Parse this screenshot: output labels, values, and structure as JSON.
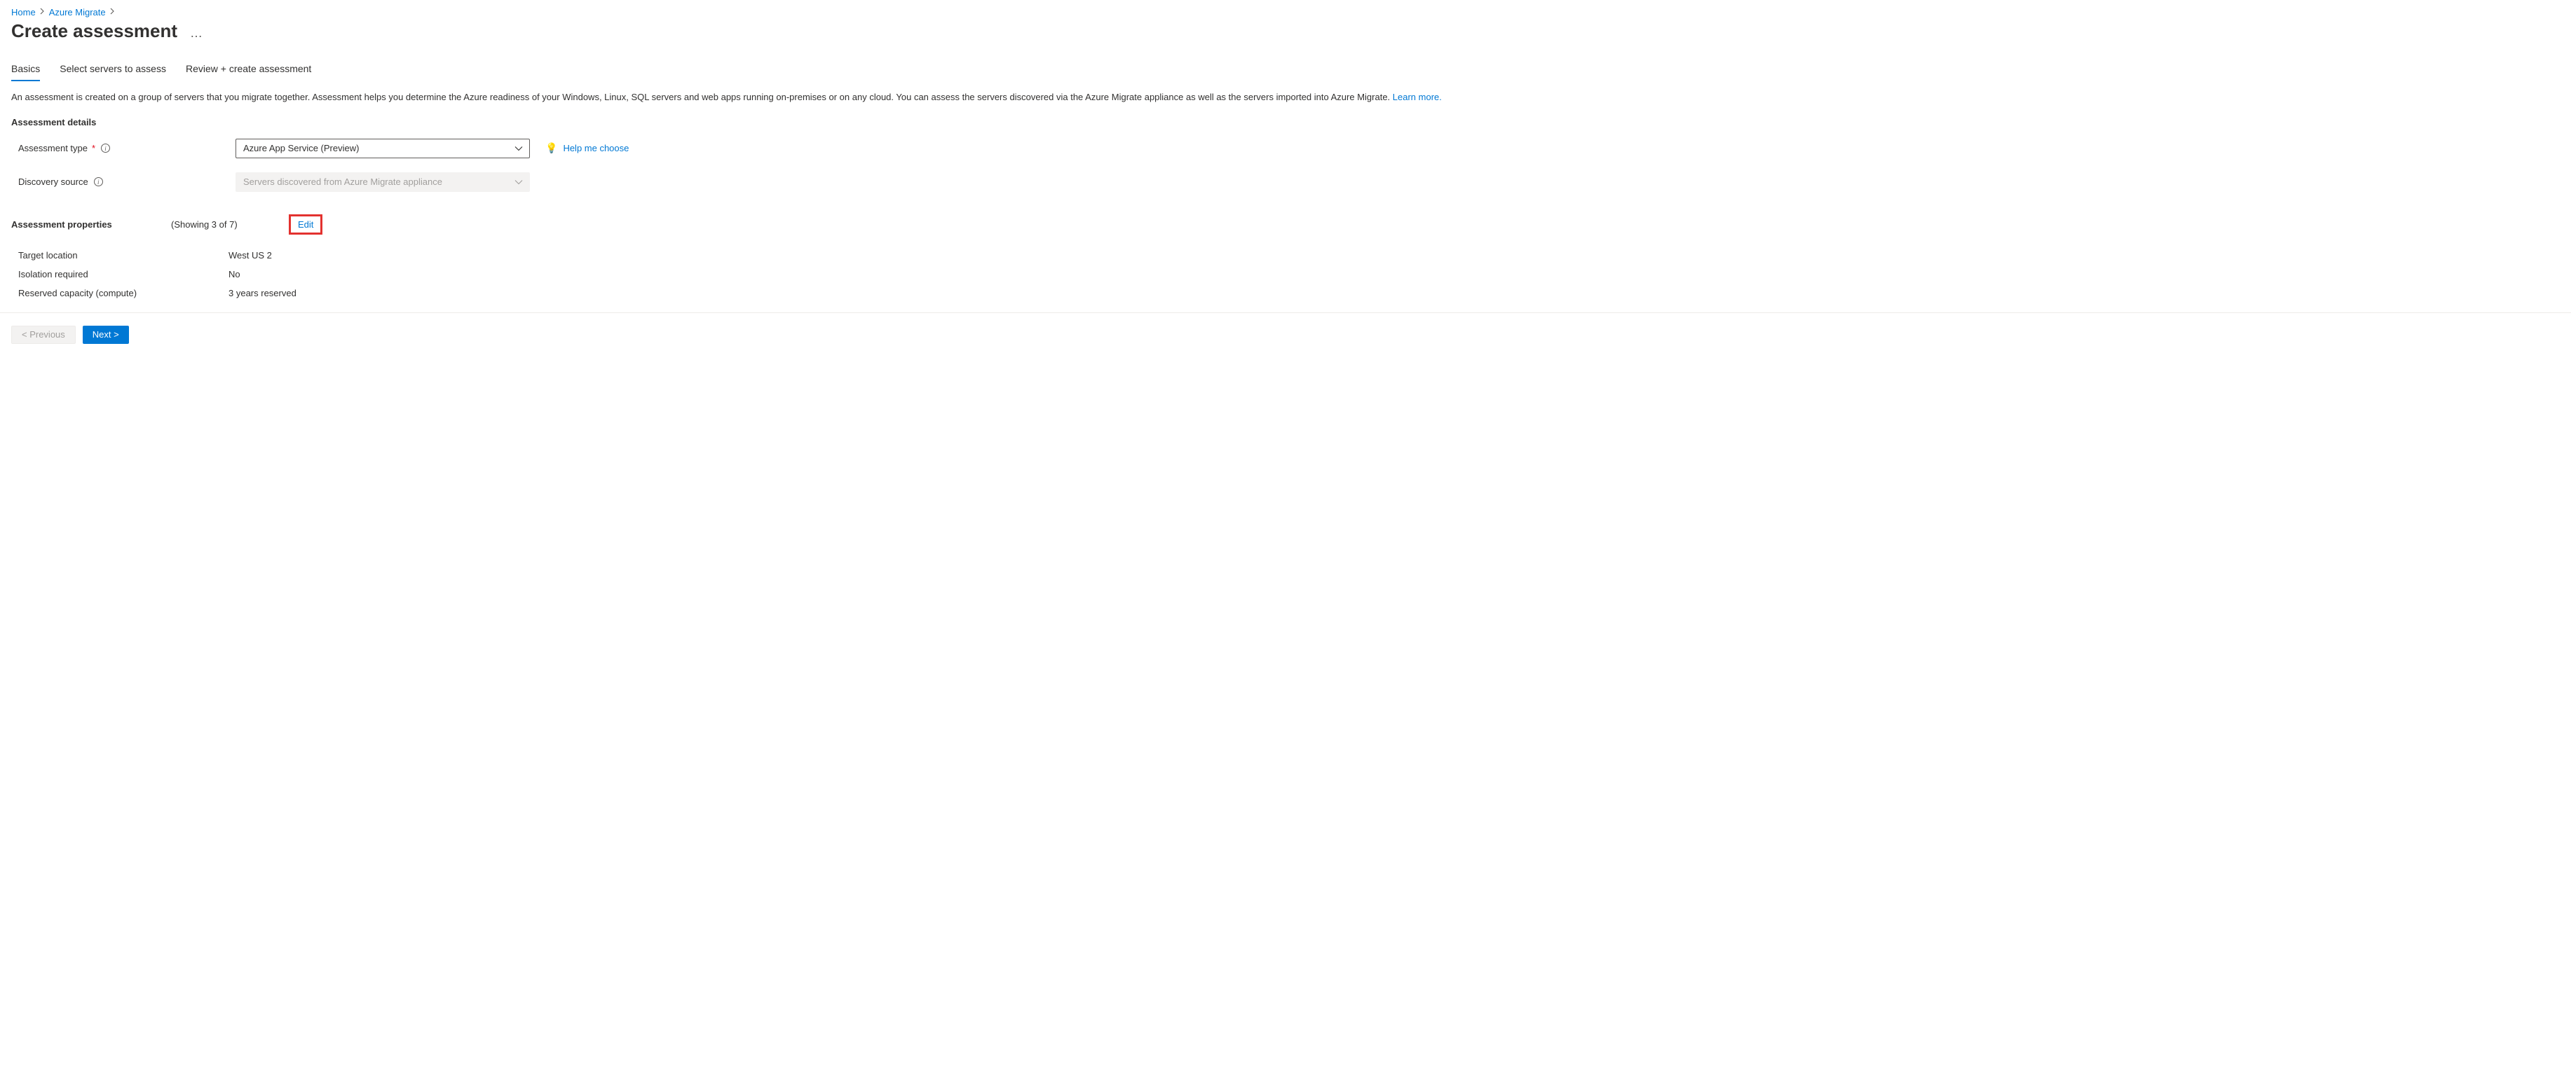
{
  "breadcrumb": {
    "home": "Home",
    "azure_migrate": "Azure Migrate"
  },
  "page_title": "Create assessment",
  "tabs": {
    "basics": "Basics",
    "select_servers": "Select servers to assess",
    "review_create": "Review + create assessment"
  },
  "intro_text": "An assessment is created on a group of servers that you migrate together. Assessment helps you determine the Azure readiness of your Windows, Linux, SQL servers and web apps running on-premises or on any cloud. You can assess the servers discovered via the Azure Migrate appliance as well as the servers imported into Azure Migrate. ",
  "intro_learn_more": "Learn more.",
  "sections": {
    "assessment_details": "Assessment details",
    "assessment_properties": "Assessment properties"
  },
  "fields": {
    "assessment_type": {
      "label": "Assessment type",
      "value": "Azure App Service (Preview)"
    },
    "discovery_source": {
      "label": "Discovery source",
      "value": "Servers discovered from Azure Migrate appliance"
    }
  },
  "help_choose": "Help me choose",
  "properties": {
    "showing": "(Showing 3 of 7)",
    "edit": "Edit",
    "rows": {
      "target_location": {
        "label": "Target location",
        "value": "West US 2"
      },
      "isolation_required": {
        "label": "Isolation required",
        "value": "No"
      },
      "reserved_capacity": {
        "label": "Reserved capacity (compute)",
        "value": "3 years reserved"
      }
    }
  },
  "footer": {
    "previous": "< Previous",
    "next": "Next >"
  }
}
